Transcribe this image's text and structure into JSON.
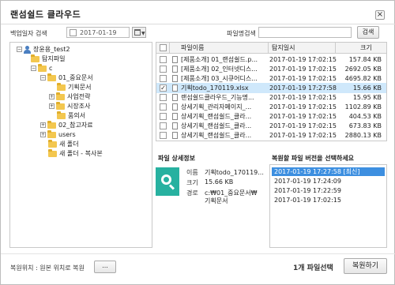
{
  "window": {
    "title": "랜섬쉴드 클라우드",
    "close_glyph": "×"
  },
  "toolbar": {
    "backup_date_label": "백업일자 검색",
    "backup_date_value": "2017-01-19",
    "filename_search_label": "파일명검색",
    "filename_search_value": "",
    "search_button": "검색"
  },
  "tree": {
    "items": [
      {
        "label": "장윤용_test2",
        "icon": "user-icon",
        "toggle": "−"
      },
      {
        "label": "탐지파일",
        "icon": "folder-icon",
        "toggle": ""
      },
      {
        "label": "c",
        "icon": "folder-icon",
        "toggle": "−"
      },
      {
        "label": "01_중요문서",
        "icon": "folder-icon",
        "toggle": "−"
      },
      {
        "label": "기획문서",
        "icon": "folder-icon",
        "toggle": ""
      },
      {
        "label": "사업전략",
        "icon": "folder-icon",
        "toggle": "+"
      },
      {
        "label": "시장조사",
        "icon": "folder-icon",
        "toggle": "+"
      },
      {
        "label": "품의서",
        "icon": "folder-icon",
        "toggle": ""
      },
      {
        "label": "02_참고자료",
        "icon": "folder-icon",
        "toggle": "+"
      },
      {
        "label": "users",
        "icon": "folder-icon",
        "toggle": "+"
      },
      {
        "label": "새 폴더",
        "icon": "folder-icon",
        "toggle": ""
      },
      {
        "label": "새 폴더 - 복사본",
        "icon": "folder-icon",
        "toggle": ""
      }
    ]
  },
  "file_list": {
    "columns": {
      "name": "파일이름",
      "detected": "탐지일시",
      "size": "크기"
    },
    "rows": [
      {
        "name": "[제품소개] 01_랜섬쉴드.p...",
        "detected": "2017-01-19 17:02:15",
        "size": "157.84 KB",
        "checked": false,
        "selected": false
      },
      {
        "name": "[제품소개] 02_인터넷디스...",
        "detected": "2017-01-19 17:02:15",
        "size": "2692.05 KB",
        "checked": false,
        "selected": false
      },
      {
        "name": "[제품소개] 03_시큐어디스...",
        "detected": "2017-01-19 17:02:15",
        "size": "4695.82 KB",
        "checked": false,
        "selected": false
      },
      {
        "name": "기획todo_170119.xlsx",
        "detected": "2017-01-19 17:27:58",
        "size": "15.66 KB",
        "checked": true,
        "selected": true
      },
      {
        "name": "랜섬쉴드클라우드_기능명...",
        "detected": "2017-01-19 17:02:15",
        "size": "15.95 KB",
        "checked": false,
        "selected": false
      },
      {
        "name": "상세기획_관리자페이지_...",
        "detected": "2017-01-19 17:02:15",
        "size": "1102.89 KB",
        "checked": false,
        "selected": false
      },
      {
        "name": "상세기획_랜섬쉴드_클라...",
        "detected": "2017-01-19 17:02:15",
        "size": "404.53 KB",
        "checked": false,
        "selected": false
      },
      {
        "name": "상세기획_랜섬쉴드_클라...",
        "detected": "2017-01-19 17:02:15",
        "size": "673.83 KB",
        "checked": false,
        "selected": false
      },
      {
        "name": "상세기획_랜섬쉴드_클라...",
        "detected": "2017-01-19 17:02:15",
        "size": "2880.13 KB",
        "checked": false,
        "selected": false
      }
    ]
  },
  "details": {
    "title": "파일 상세정보",
    "name_label": "이름",
    "name_value": "기획todo_170119...",
    "size_label": "크기",
    "size_value": "15.66 KB",
    "path_label": "경로",
    "path_value_1": "c:₩01_중요문서₩",
    "path_value_2": "기획문서"
  },
  "versions": {
    "title": "복원할 파일 버전을 선택하세요",
    "items": [
      {
        "label": "2017-01-19 17:27:58 [최신]",
        "selected": true
      },
      {
        "label": "2017-01-19 17:24:09",
        "selected": false
      },
      {
        "label": "2017-01-19 17:22:59",
        "selected": false
      },
      {
        "label": "2017-01-19 17:02:15",
        "selected": false
      }
    ]
  },
  "footer": {
    "restore_location_label": "복원위치 : 원본 위치로 복원",
    "browse_button": "...",
    "selection_count": "1개 파일선택",
    "restore_button": "복원하기"
  },
  "colors": {
    "accent": "#27b1a0",
    "selection": "#3d8fe0",
    "row_highlight": "#cfe8fb",
    "folder": "#f3c74f"
  }
}
